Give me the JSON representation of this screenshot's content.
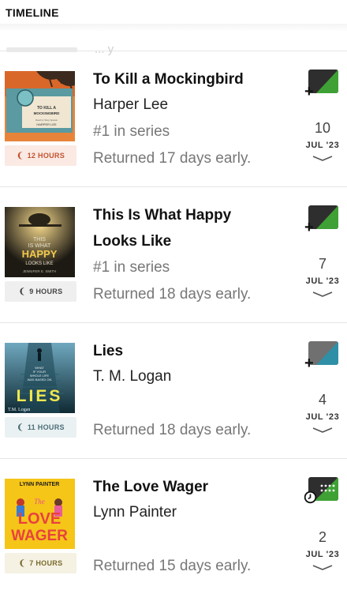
{
  "header": {
    "title": "TIMELINE"
  },
  "prev_row": {
    "faint_text": "... y"
  },
  "books": [
    {
      "title": "To Kill a Mockingbird",
      "author": "Harper Lee",
      "series": "#1 in series",
      "status": "Returned 17 days early.",
      "duration": "12 HOURS",
      "duration_bg": "#fbe9e3",
      "duration_color": "#c2542f",
      "date_day": "10",
      "date_month": "JUL '23",
      "action_icon": "add-to-list-icon",
      "cover": {
        "title_lines": [
          "TO KILL A",
          "MOCKINGBIRD"
        ],
        "author": "HARPER LEE",
        "small": "Read by Sissy Spacek"
      }
    },
    {
      "title": "This Is What Happy Looks Like",
      "author": "",
      "series": "#1 in series",
      "status": "Returned 18 days early.",
      "duration": "9 HOURS",
      "duration_bg": "#efefef",
      "duration_color": "#444444",
      "date_day": "7",
      "date_month": "JUL '23",
      "action_icon": "add-to-list-icon",
      "cover": {
        "title_lines": [
          "THIS",
          "IS WHAT",
          "HAPPY",
          "LOOKS LIKE"
        ],
        "author": "JENNIFER E. SMITH"
      }
    },
    {
      "title": "Lies",
      "author": "T. M. Logan",
      "series": "",
      "status": "Returned 18 days early.",
      "duration": "11 HOURS",
      "duration_bg": "#eaf1f2",
      "duration_color": "#4a6d78",
      "date_day": "4",
      "date_month": "JUL '23",
      "action_icon": "add-to-list-icon",
      "cover": {
        "tagline": [
          "WHAT",
          "IF YOUR",
          "WHOLE LIFE",
          "WAS BASED ON"
        ],
        "title": "LIES",
        "author": "T.M. Logan"
      }
    },
    {
      "title": "The Love Wager",
      "author": "Lynn Painter",
      "series": "",
      "status": "Returned 15 days early.",
      "duration": "7 HOURS",
      "duration_bg": "#f5f1e3",
      "duration_color": "#7a6a2c",
      "date_day": "2",
      "date_month": "JUL '23",
      "action_icon": "reading-progress-icon",
      "cover": {
        "author": "LYNN PAINTER",
        "title_lines": [
          "The",
          "LOVE",
          "WAGER"
        ]
      }
    }
  ]
}
